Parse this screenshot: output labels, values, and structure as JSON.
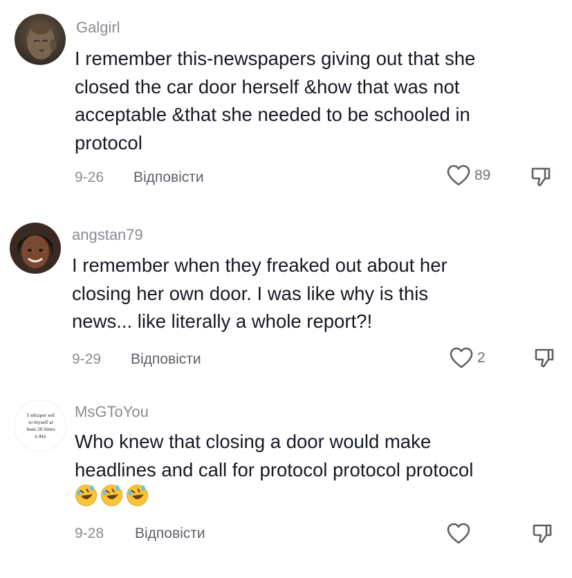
{
  "comments": [
    {
      "username": "Galgirl",
      "text": "I remember this-newspapers giving out that she\nclosed the car door herself &how that was not\nacceptable &that she needed to be schooled in\nprotocol",
      "date": "9-26",
      "reply_label": "Відповісти",
      "likes": "89",
      "avatar": "buddha-statue-avatar"
    },
    {
      "username": "angstan79",
      "text": "I remember when they freaked out about her\nclosing her own door. I was like why is this\nnews... like literally a whole report?!",
      "date": "9-29",
      "reply_label": "Відповісти",
      "likes": "2",
      "avatar": "person-photo-avatar"
    },
    {
      "username": "MsGToYou",
      "text": "Who knew that closing a door would make\nheadlines and call for protocol protocol protocol",
      "emoji": [
        "🤣",
        "🤣",
        "🤣"
      ],
      "date": "9-28",
      "reply_label": "Відповісти",
      "likes": "",
      "avatar": "text-quote-avatar",
      "avatar_text": "I whisper wtf to myself at least 20 times a day."
    }
  ],
  "colors": {
    "primary_text": "#161823",
    "secondary_text": "#8a8b91",
    "background": "#ffffff"
  }
}
